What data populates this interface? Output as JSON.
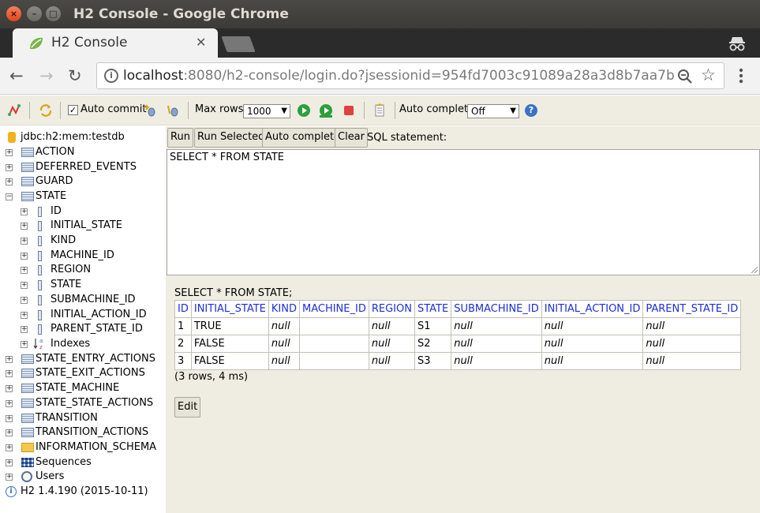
{
  "window": {
    "title": "H2 Console - Google Chrome"
  },
  "tab": {
    "title": "H2 Console"
  },
  "address": {
    "host": "localhost",
    "rest": ":8080/h2-console/login.do?jsessionid=954fd7003c91089a28a3d8b7aa7b…"
  },
  "toolbar": {
    "auto_commit_label": "Auto commit",
    "max_rows_label": "Max rows:",
    "max_rows_value": "1000",
    "auto_complete_label": "Auto complete",
    "auto_complete_value": "Off"
  },
  "tree": {
    "connection": "jdbc:h2:mem:testdb",
    "tables_before": [
      "ACTION",
      "DEFERRED_EVENTS",
      "GUARD"
    ],
    "expanded_table": "STATE",
    "columns": [
      "ID",
      "INITIAL_STATE",
      "KIND",
      "MACHINE_ID",
      "REGION",
      "STATE",
      "SUBMACHINE_ID",
      "INITIAL_ACTION_ID",
      "PARENT_STATE_ID"
    ],
    "indexes_label": "Indexes",
    "tables_after": [
      "STATE_ENTRY_ACTIONS",
      "STATE_EXIT_ACTIONS",
      "STATE_MACHINE",
      "STATE_STATE_ACTIONS",
      "TRANSITION",
      "TRANSITION_ACTIONS"
    ],
    "schema": "INFORMATION_SCHEMA",
    "sequences": "Sequences",
    "users": "Users",
    "version": "H2 1.4.190 (2015-10-11)"
  },
  "editor": {
    "run": "Run",
    "run_selected": "Run Selected",
    "auto_complete": "Auto complete",
    "clear": "Clear",
    "sql_label": "SQL statement:",
    "sql": "SELECT * FROM STATE"
  },
  "result": {
    "statement": "SELECT * FROM STATE;",
    "headers": [
      "ID",
      "INITIAL_STATE",
      "KIND",
      "MACHINE_ID",
      "REGION",
      "STATE",
      "SUBMACHINE_ID",
      "INITIAL_ACTION_ID",
      "PARENT_STATE_ID"
    ],
    "rows": [
      [
        "1",
        "TRUE",
        "null",
        "",
        "null",
        "S1",
        "null",
        "null",
        "null"
      ],
      [
        "2",
        "FALSE",
        "null",
        "",
        "null",
        "S2",
        "null",
        "null",
        "null"
      ],
      [
        "3",
        "FALSE",
        "null",
        "",
        "null",
        "S3",
        "null",
        "null",
        "null"
      ]
    ],
    "summary": "(3 rows, 4 ms)",
    "edit": "Edit"
  }
}
